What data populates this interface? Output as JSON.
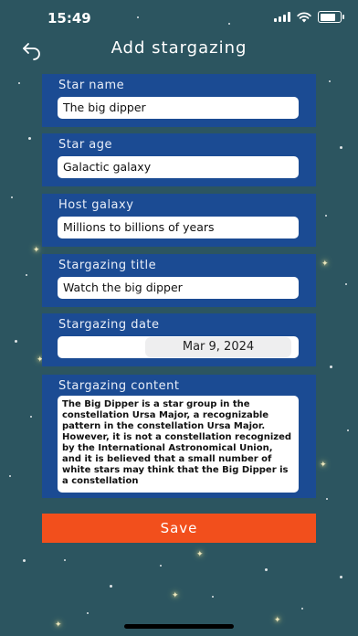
{
  "status_bar": {
    "time": "15:49"
  },
  "header": {
    "title": "Add stargazing"
  },
  "fields": [
    {
      "label": "Star name",
      "value": "The big dipper"
    },
    {
      "label": "Star age",
      "value": "Galactic galaxy"
    },
    {
      "label": "Host galaxy",
      "value": "Millions to billions of years"
    },
    {
      "label": "Stargazing title",
      "value": "Watch the big dipper"
    }
  ],
  "date_field": {
    "label": "Stargazing date",
    "value": "Mar 9, 2024"
  },
  "content_field": {
    "label": "Stargazing content",
    "value": "The Big Dipper is a star group in the constellation Ursa Major, a recognizable pattern in the constellation Ursa Major. However, it is not a constellation recognized by the International Astronomical Union, and it is believed that a small number of white stars may think that the Big Dipper is a constellation"
  },
  "save_label": "Save",
  "colors": {
    "background": "#2c5560",
    "card": "#1b4b93",
    "save": "#f24f1c"
  },
  "icons": {
    "back": "back-arrow-icon",
    "signal": "signal-icon",
    "wifi": "wifi-icon",
    "battery": "battery-icon"
  }
}
